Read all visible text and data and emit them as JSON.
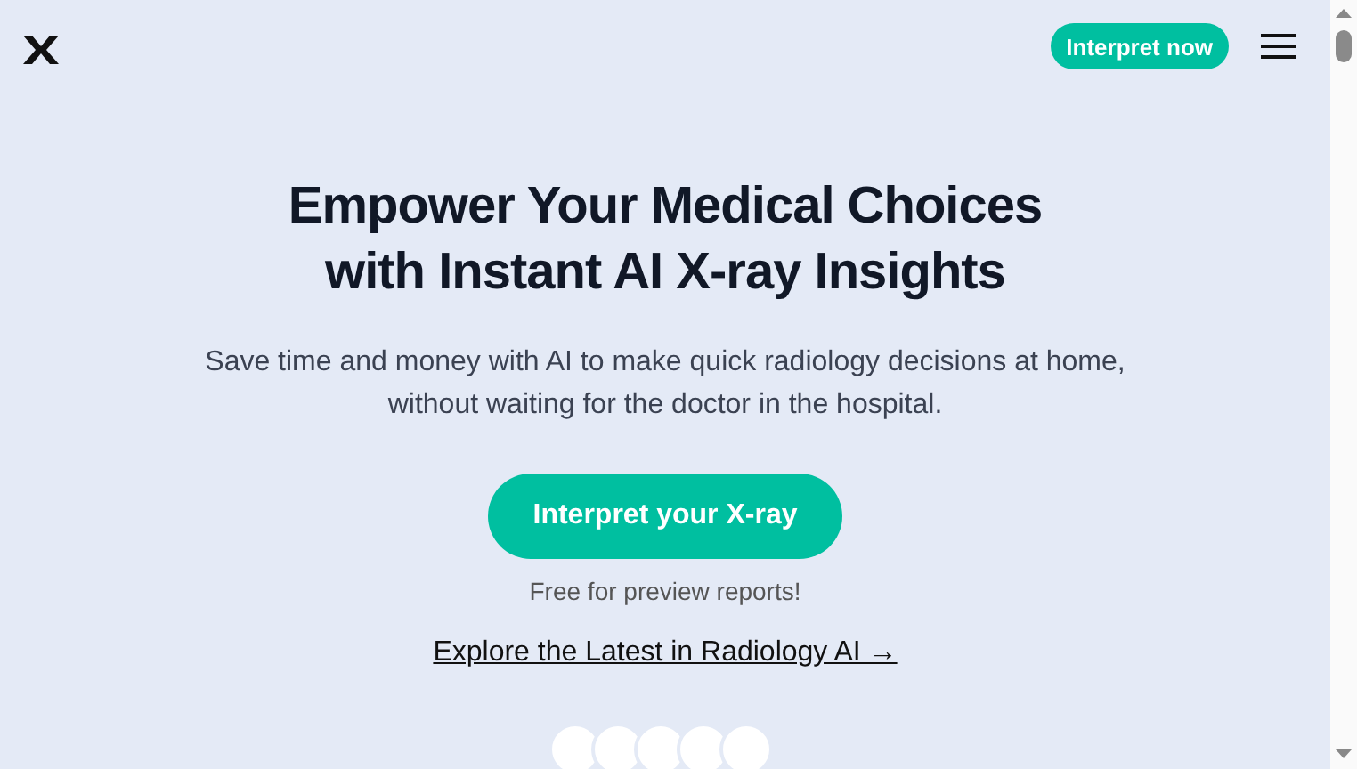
{
  "header": {
    "cta": "Interpret now"
  },
  "hero": {
    "title_lines": [
      "Empower Your Medical Choices",
      "with Instant AI X-ray Insights"
    ],
    "subtitle_lines": [
      "Save time and money with AI to make quick radiology decisions at home,",
      "without waiting for the doctor in the hospital."
    ],
    "button": "Interpret your X-ray",
    "note": "Free for preview reports!",
    "link": "Explore the Latest in Radiology AI →",
    "avatars": [
      {
        "kind": "avatar"
      },
      {
        "kind": "avatar"
      },
      {
        "kind": "avatar"
      },
      {
        "kind": "avatar"
      },
      {
        "kind": "avatar"
      }
    ]
  }
}
